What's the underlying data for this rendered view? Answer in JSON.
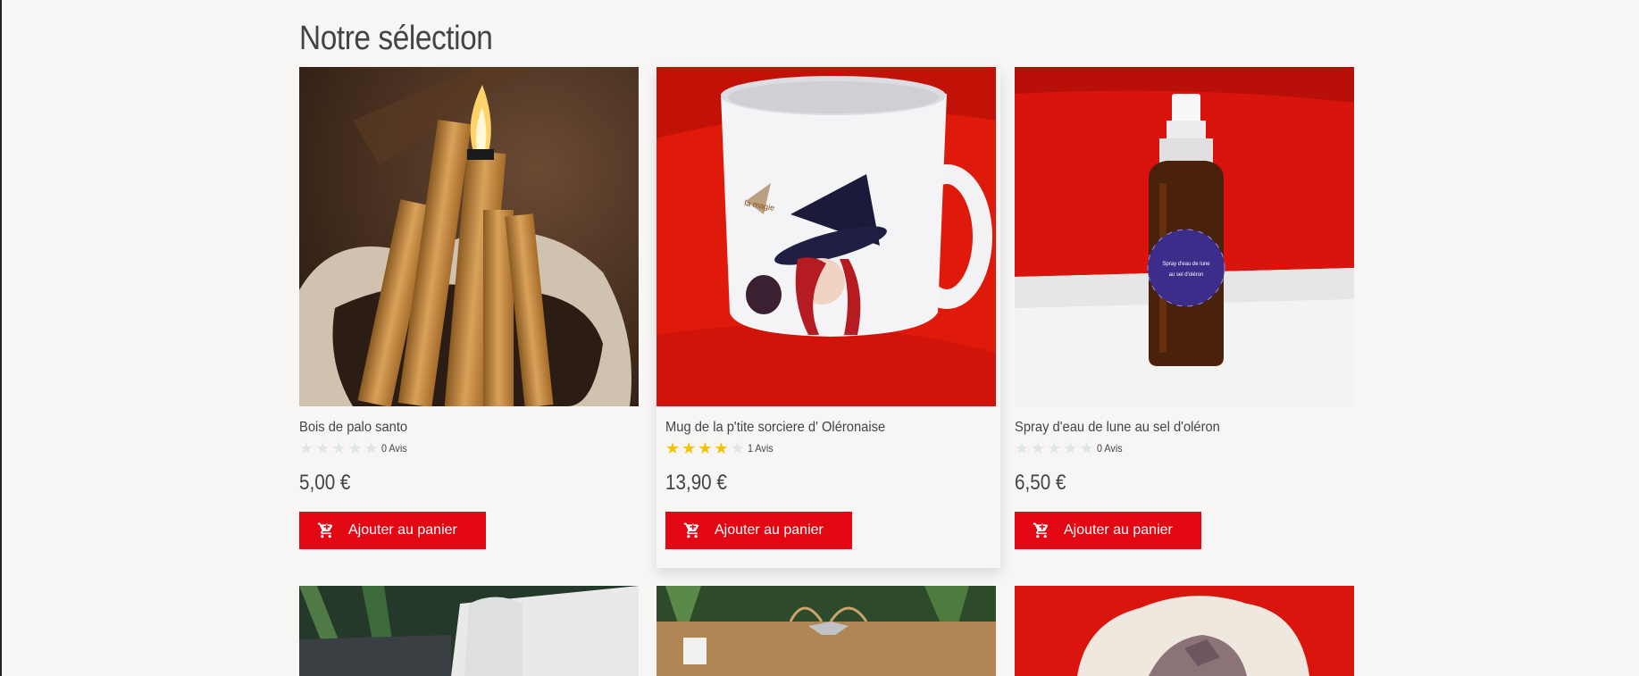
{
  "section": {
    "title": "Notre sélection"
  },
  "products": [
    {
      "name": "Bois de palo santo",
      "rating": 0,
      "max_rating": 5,
      "reviews": "0 Avis",
      "price": "5,00 €",
      "button": "Ajouter au panier",
      "image_alt": "palo-santo-sticks-burning"
    },
    {
      "name": "Mug de la p'tite sorciere d' Oléronaise",
      "rating": 4,
      "max_rating": 5,
      "reviews": "1 Avis",
      "price": "13,90 €",
      "button": "Ajouter au panier",
      "image_alt": "witch-mug-on-red-cloth"
    },
    {
      "name": "Spray d'eau de lune au sel d'oléron",
      "rating": 0,
      "max_rating": 5,
      "reviews": "0 Avis",
      "price": "6,50 €",
      "button": "Ajouter au panier",
      "image_alt": "moon-water-spray-bottle"
    }
  ],
  "colors": {
    "accent": "#e30613",
    "star_on": "#f2c200",
    "star_off": "#dde8e6",
    "background": "#f7f6f4"
  },
  "icons": {
    "cart": "cart-plus-icon",
    "star": "star-icon"
  }
}
